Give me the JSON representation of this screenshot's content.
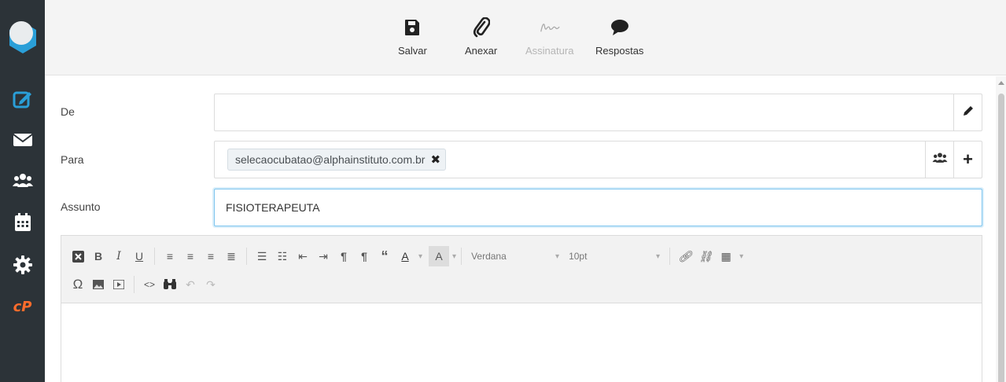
{
  "toolbar": {
    "save_label": "Salvar",
    "attach_label": "Anexar",
    "signature_label": "Assinatura",
    "responses_label": "Respostas"
  },
  "form": {
    "from_label": "De",
    "from_value": "",
    "to_label": "Para",
    "recipients": [
      "selecaocubatao@alphainstituto.com.br"
    ],
    "subject_label": "Assunto",
    "subject_value": "FISIOTERAPEUTA"
  },
  "editor": {
    "font_family": "Verdana",
    "font_size": "10pt"
  },
  "sidebar": {
    "items": [
      "compose-icon",
      "mail-icon",
      "contacts-icon",
      "calendar-icon",
      "settings-icon",
      "cpanel-icon"
    ]
  },
  "colors": {
    "sidebar_bg": "#2c3338",
    "accent_blue": "#2a9fd8",
    "cpanel_orange": "#ff6c2c",
    "focus_border": "#7cc4ee"
  }
}
